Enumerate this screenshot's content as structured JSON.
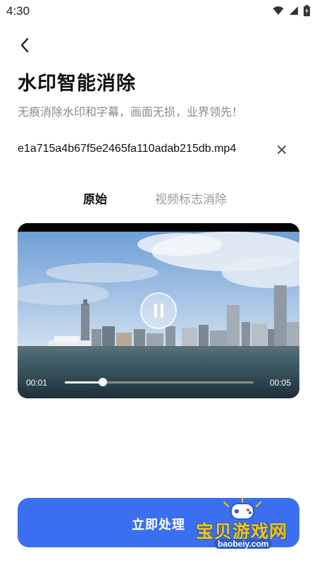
{
  "status_bar": {
    "time": "4:30"
  },
  "header": {
    "title": "水印智能消除",
    "subtitle": "无痕消除水印和字幕，画面无损，业界领先！"
  },
  "file": {
    "name": "e1a715a4b67f5e2465fa110adab215db.mp4"
  },
  "tabs": [
    {
      "label": "原始",
      "active": true
    },
    {
      "label": "视频标志消除",
      "active": false
    }
  ],
  "player": {
    "current_time": "00:01",
    "total_time": "00:05",
    "progress": 0.2,
    "state": "playing"
  },
  "actions": {
    "process_label": "立即处理"
  },
  "watermark": {
    "text": "宝贝游戏网",
    "url": "baobeiy.com"
  },
  "colors": {
    "accent": "#3b6ff2",
    "watermark_yellow": "#f5c400",
    "watermark_blue": "#2a5ac8"
  }
}
